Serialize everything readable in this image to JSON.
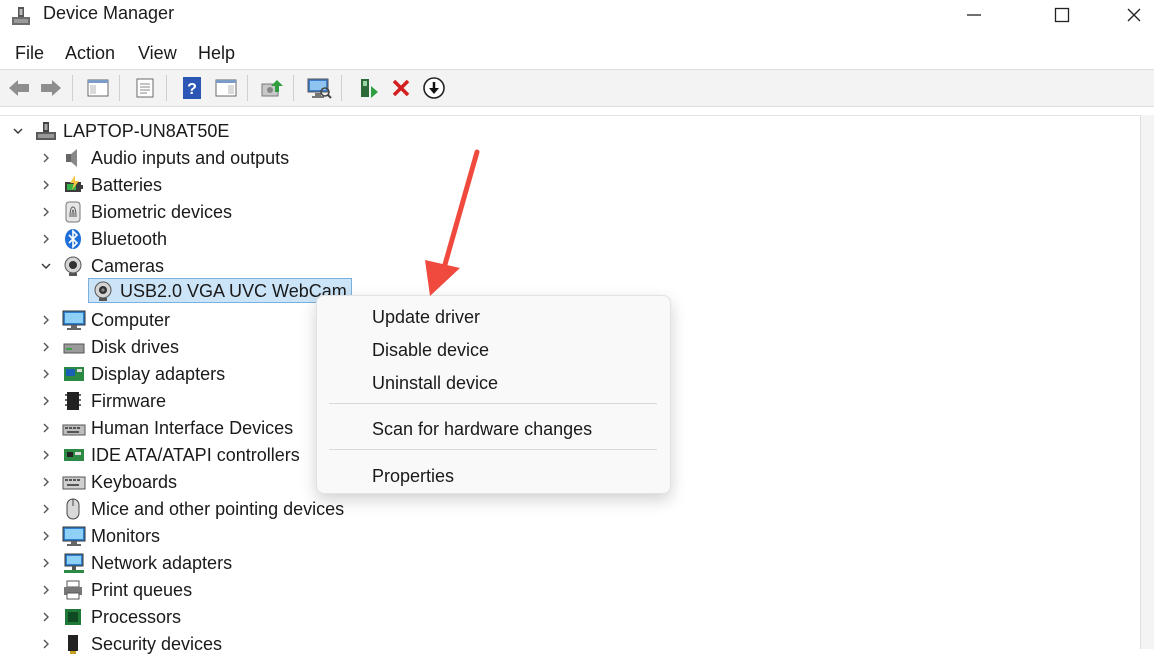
{
  "window": {
    "title": "Device Manager"
  },
  "menu": [
    "File",
    "Action",
    "View",
    "Help"
  ],
  "toolbar": {
    "buttons": [
      "back-icon",
      "forward-icon",
      "show-hide-console-tree-icon",
      "properties-icon",
      "help-icon",
      "action-pane-icon",
      "update-driver-icon",
      "scan-hardware-icon",
      "enable-device-icon",
      "uninstall-icon",
      "download-driver-icon"
    ]
  },
  "tree": {
    "root": "LAPTOP-UN8AT50E",
    "categories": [
      {
        "label": "Audio inputs and outputs",
        "icon": "speaker-icon",
        "expanded": false
      },
      {
        "label": "Batteries",
        "icon": "battery-icon",
        "expanded": false
      },
      {
        "label": "Biometric devices",
        "icon": "fingerprint-icon",
        "expanded": false
      },
      {
        "label": "Bluetooth",
        "icon": "bluetooth-icon",
        "expanded": false
      },
      {
        "label": "Cameras",
        "icon": "camera-icon",
        "expanded": true
      },
      {
        "label": "Computer",
        "icon": "monitor-icon",
        "expanded": false
      },
      {
        "label": "Disk drives",
        "icon": "disk-drive-icon",
        "expanded": false
      },
      {
        "label": "Display adapters",
        "icon": "display-adapter-icon",
        "expanded": false
      },
      {
        "label": "Firmware",
        "icon": "chip-icon",
        "expanded": false
      },
      {
        "label": "Human Interface Devices",
        "icon": "hid-icon",
        "expanded": false
      },
      {
        "label": "IDE ATA/ATAPI controllers",
        "icon": "ide-controller-icon",
        "expanded": false
      },
      {
        "label": "Keyboards",
        "icon": "keyboard-icon",
        "expanded": false
      },
      {
        "label": "Mice and other pointing devices",
        "icon": "mouse-icon",
        "expanded": false
      },
      {
        "label": "Monitors",
        "icon": "monitor-icon",
        "expanded": false
      },
      {
        "label": "Network adapters",
        "icon": "network-icon",
        "expanded": false
      },
      {
        "label": "Print queues",
        "icon": "printer-icon",
        "expanded": false
      },
      {
        "label": "Processors",
        "icon": "processor-icon",
        "expanded": false
      },
      {
        "label": "Security devices",
        "icon": "security-icon",
        "expanded": false
      }
    ],
    "selected_device": "USB2.0 VGA UVC WebCam"
  },
  "context_menu": {
    "items": [
      "Update driver",
      "Disable device",
      "Uninstall device",
      "Scan for hardware changes",
      "Properties"
    ]
  },
  "colors": {
    "selection": "#cce4f7",
    "annotation_arrow": "#f04a3e",
    "uninstall_x": "#d21f1f"
  }
}
